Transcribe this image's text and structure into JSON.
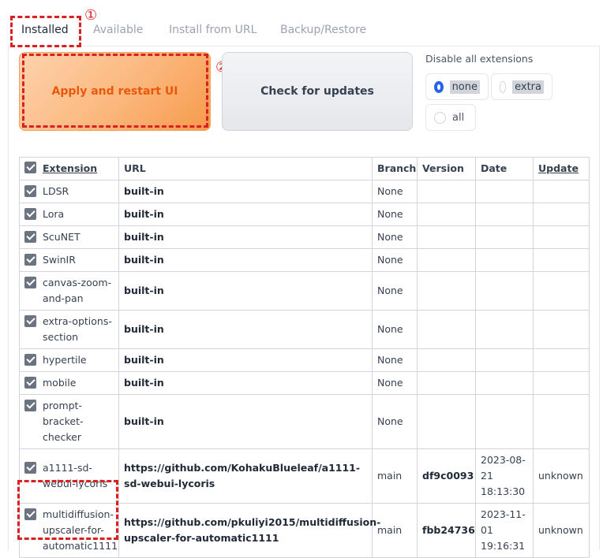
{
  "tabs": [
    {
      "label": "Installed"
    },
    {
      "label": "Available"
    },
    {
      "label": "Install from URL"
    },
    {
      "label": "Backup/Restore"
    }
  ],
  "markers": {
    "one": "①",
    "two": "②"
  },
  "buttons": {
    "apply": "Apply and restart UI",
    "check": "Check for updates"
  },
  "disable": {
    "label": "Disable all extensions",
    "options": [
      "none",
      "extra",
      "all"
    ],
    "selected": "none"
  },
  "table": {
    "headers": {
      "extension": "Extension",
      "url": "URL",
      "branch": "Branch",
      "version": "Version",
      "date": "Date",
      "update": "Update"
    },
    "rows": [
      {
        "name": "LDSR",
        "url": "built-in",
        "branch": "None",
        "version": "",
        "date": "",
        "update": ""
      },
      {
        "name": "Lora",
        "url": "built-in",
        "branch": "None",
        "version": "",
        "date": "",
        "update": ""
      },
      {
        "name": "ScuNET",
        "url": "built-in",
        "branch": "None",
        "version": "",
        "date": "",
        "update": ""
      },
      {
        "name": "SwinIR",
        "url": "built-in",
        "branch": "None",
        "version": "",
        "date": "",
        "update": ""
      },
      {
        "name": "canvas-zoom-and-pan",
        "url": "built-in",
        "branch": "None",
        "version": "",
        "date": "",
        "update": ""
      },
      {
        "name": "extra-options-section",
        "url": "built-in",
        "branch": "None",
        "version": "",
        "date": "",
        "update": ""
      },
      {
        "name": "hypertile",
        "url": "built-in",
        "branch": "None",
        "version": "",
        "date": "",
        "update": ""
      },
      {
        "name": "mobile",
        "url": "built-in",
        "branch": "None",
        "version": "",
        "date": "",
        "update": ""
      },
      {
        "name": "prompt-bracket-checker",
        "url": "built-in",
        "branch": "None",
        "version": "",
        "date": "",
        "update": ""
      },
      {
        "name": "a1111-sd-webui-lycoris",
        "url": "https://github.com/KohakuBlueleaf/a1111-sd-webui-lycoris",
        "branch": "main",
        "version": "df9c0093",
        "date": "2023-08-21 18:13:30",
        "update": "unknown"
      },
      {
        "name": "multidiffusion-upscaler-for-automatic1111",
        "url": "https://github.com/pkuliyi2015/multidiffusion-upscaler-for-automatic1111",
        "branch": "main",
        "version": "fbb24736",
        "date": "2023-11-01 19:16:31",
        "update": "unknown"
      }
    ]
  },
  "colors": {
    "accent": "#ea580c",
    "annotation": "#d92121",
    "radio": "#2563eb"
  }
}
